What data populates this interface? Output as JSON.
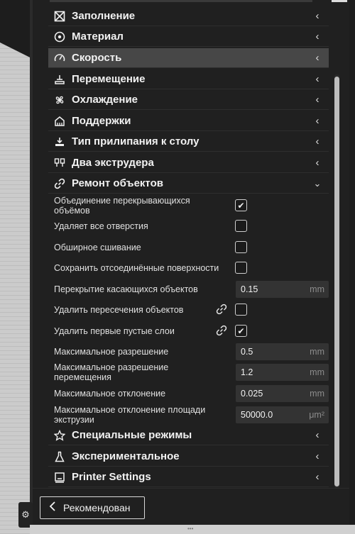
{
  "categories": [
    {
      "label": "Заполнение",
      "icon": "infill-icon"
    },
    {
      "label": "Материал",
      "icon": "material-icon"
    },
    {
      "label": "Скорость",
      "icon": "speed-icon"
    },
    {
      "label": "Перемещение",
      "icon": "travel-icon"
    },
    {
      "label": "Охлаждение",
      "icon": "cooling-icon"
    },
    {
      "label": "Поддержки",
      "icon": "support-icon"
    },
    {
      "label": "Тип прилипания к столу",
      "icon": "adhesion-icon"
    },
    {
      "label": "Два экструдера",
      "icon": "dual-extruder-icon"
    },
    {
      "label": "Ремонт объектов",
      "icon": "mesh-fix-icon"
    }
  ],
  "mesh_fixes": {
    "union_overlapping": {
      "label": "Объединение перекрывающихся объёмов",
      "checked": true
    },
    "remove_holes": {
      "label": "Удаляет все отверстия",
      "checked": false
    },
    "extensive_stitching": {
      "label": "Обширное сшивание",
      "checked": false
    },
    "keep_disconnected": {
      "label": "Сохранить отсоединённые поверхности",
      "checked": false
    },
    "overlap": {
      "label": "Перекрытие касающихся объектов",
      "value": "0.15",
      "unit": "mm"
    },
    "remove_intersections": {
      "label": "Удалить пересечения объектов",
      "checked": false
    },
    "remove_empty_layers": {
      "label": "Удалить первые пустые слои",
      "checked": true
    },
    "max_resolution": {
      "label": "Максимальное разрешение",
      "value": "0.5",
      "unit": "mm"
    },
    "max_travel_resolution": {
      "label": "Максимальное разрешение перемещения",
      "value": "1.2",
      "unit": "mm"
    },
    "max_deviation": {
      "label": "Максимальное отклонение",
      "value": "0.025",
      "unit": "mm"
    },
    "max_area_deviation": {
      "label": "Максимальное отклонение площади экструзии",
      "value": "50000.0",
      "unit": "μm²"
    }
  },
  "bottom_categories": [
    {
      "label": "Специальные режимы",
      "icon": "special-modes-icon"
    },
    {
      "label": "Экспериментальное",
      "icon": "experimental-icon"
    },
    {
      "label": "Printer Settings",
      "icon": "printer-settings-icon"
    }
  ],
  "recommended_button": "Рекомендован",
  "check_mark": "✔",
  "chevron_left": "‹",
  "chevron_down": "⌄"
}
